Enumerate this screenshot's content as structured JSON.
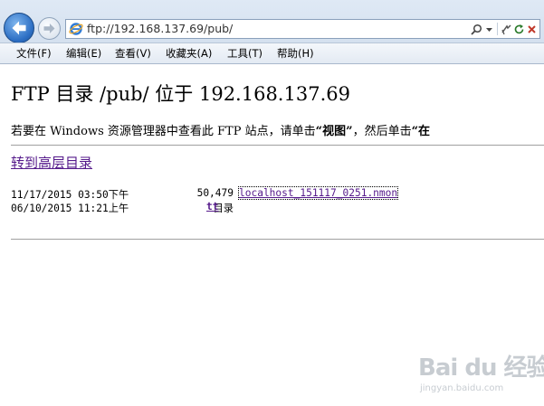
{
  "browser": {
    "address": "ftp://192.168.137.69/pub/",
    "menu": [
      "文件(F)",
      "编辑(E)",
      "查看(V)",
      "收藏夹(A)",
      "工具(T)",
      "帮助(H)"
    ]
  },
  "page": {
    "title": "FTP 目录 /pub/ 位于 192.168.137.69",
    "instruction": {
      "part1": "若要在 Windows 资源管理器中查看此 FTP 站点，请单击",
      "bold1": "“视图”",
      "part2": "，然后单击",
      "bold2": "“在"
    },
    "parent_link": "转到高层目录",
    "entries": [
      {
        "date": "11/17/2015 03:50下午",
        "size": "50,479",
        "name": "localhost_151117_0251.nmon",
        "is_dir": false
      },
      {
        "date": "06/10/2015 11:21上午",
        "size": "目录",
        "name": "tt",
        "is_dir": true
      }
    ]
  },
  "watermark": {
    "brand": "Bai du 经验",
    "url": "jingyan.baidu.com"
  },
  "colors": {
    "link": "#551a8b",
    "chrome": "#dfe9f5"
  }
}
